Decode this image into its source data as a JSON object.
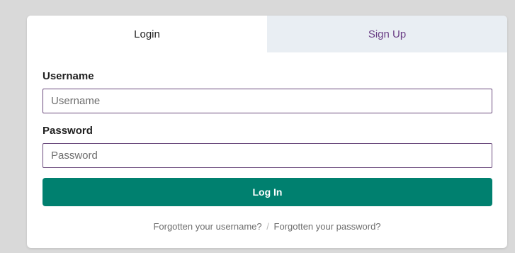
{
  "tabs": {
    "login": "Login",
    "signup": "Sign Up"
  },
  "form": {
    "username_label": "Username",
    "username_placeholder": "Username",
    "username_value": "",
    "password_label": "Password",
    "password_placeholder": "Password",
    "password_value": "",
    "submit_label": "Log In"
  },
  "links": {
    "forgot_username": "Forgotten your username?",
    "separator": "/",
    "forgot_password": "Forgotten your password?"
  },
  "colors": {
    "accent": "#00806f",
    "signup_tab_text": "#6b3f86",
    "signup_tab_bg": "#e9eef3",
    "input_border": "#6b4b7d"
  }
}
